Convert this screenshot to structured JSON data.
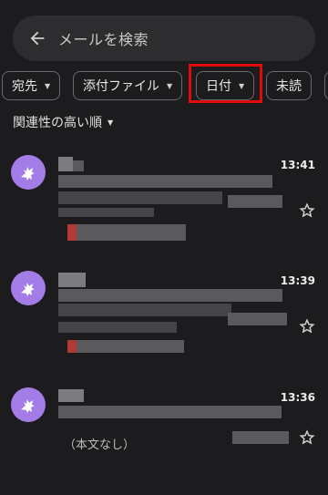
{
  "search": {
    "placeholder": "メールを検索"
  },
  "filters": [
    {
      "label": "宛先"
    },
    {
      "label": "添付ファイル"
    },
    {
      "label": "日付"
    },
    {
      "label": "未読"
    }
  ],
  "sort": {
    "label": "関連性の高い順"
  },
  "emails": [
    {
      "time": "13:41"
    },
    {
      "time": "13:39"
    },
    {
      "time": "13:36",
      "preview": "（本文なし）"
    }
  ],
  "colors": {
    "accent_highlight": "#e10a0a",
    "avatar": "#a47ce8"
  }
}
